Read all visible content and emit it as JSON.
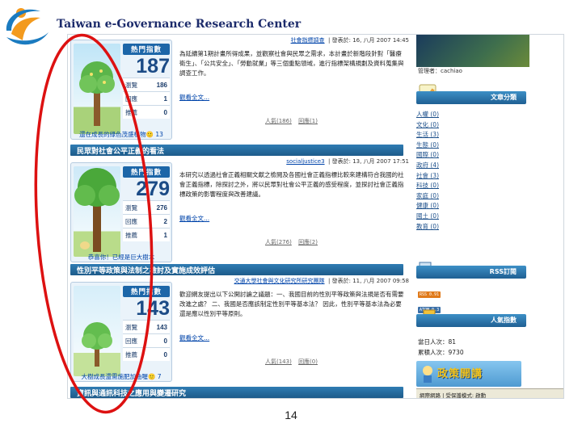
{
  "header": {
    "title": "Taiwan e-Governance Research Center"
  },
  "page_number": "14",
  "posts": [
    {
      "author_prefix": "",
      "author": "社會指標調查",
      "posted_at": "發表於: 16, 八月 2007 14:45",
      "hot_label": "熱門指數",
      "hot_count": "187",
      "stats": [
        {
          "label": "瀏覽",
          "value": "186"
        },
        {
          "label": "回應",
          "value": "1"
        },
        {
          "label": "推薦",
          "value": "0"
        }
      ],
      "caption": "還在成長的綠色茂盛植物🙂 13",
      "body": "為延續第1期計畫所得成果，並觀察社會與民眾之需求，本計畫於新階段針對「醫療衛生」、「公共安全」、「勞動就業」等三個重點領域，進行指標架構規劃及資料蒐集與調查工作。",
      "read_more": "觀看全文...",
      "links": [
        "人氣(186)",
        "回應(1)"
      ]
    },
    {
      "section_title": "民眾對社會公平正義的看法",
      "author_prefix": "",
      "author": "socialjustice3",
      "posted_at": "發表於: 13, 八月 2007 17:51",
      "hot_label": "熱門指數",
      "hot_count": "279",
      "stats": [
        {
          "label": "瀏覽",
          "value": "276"
        },
        {
          "label": "回應",
          "value": "2"
        },
        {
          "label": "推薦",
          "value": "1"
        }
      ],
      "caption": "恭喜你！已經是巨大樹木",
      "body": "本研究以透過社會正義相關文獻之檢閱及各國社會正義指標比較來建構符合我國的社會正義指標，除探討之外，將以民眾對社會公平正義的感受程度，並探討社會正義指標政策的影響程度與改善建議。",
      "read_more": "觀看全文...",
      "links": [
        "人氣(276)",
        "回應(2)"
      ]
    },
    {
      "section_title": "性別平等政策與法制之檢討及實施成效評估",
      "author_prefix": "",
      "author": "交通大學社會與文化研究所研究團隊",
      "posted_at": "發表於: 11, 八月 2007 09:58",
      "hot_label": "熱門指數",
      "hot_count": "143",
      "stats": [
        {
          "label": "瀏覽",
          "value": "143"
        },
        {
          "label": "回應",
          "value": "0"
        },
        {
          "label": "推薦",
          "value": "0"
        }
      ],
      "caption": "大樹成長還需施肥加油喔🙂 7",
      "body": "歡迎網友提出以下公開討論之議題：一、我國目前的性別平等政策與法規是否有需要改進之處？ 二、我國是否應該制定性別平等基本法？ 因此，性別平等基本法為必要還是應以性別平等原則。",
      "read_more": "觀看全文...",
      "links": [
        "人氣(143)",
        "回應(0)"
      ]
    },
    {
      "section_title": "資訊與通訊科技之應用與變遷研究"
    }
  ],
  "sidebar": {
    "owner_label": "管理者：cachiao",
    "categories_title": "文章分類",
    "categories": [
      "人權 (0)",
      "文化 (0)",
      "生活 (3)",
      "生態 (0)",
      "國際 (0)",
      "政府 (4)",
      "社會 (3)",
      "科技 (0)",
      "家庭 (0)",
      "健康 (0)",
      "國土 (0)",
      "教育 (0)"
    ],
    "rss_title": "RSS訂閱",
    "rss_badges": [
      "RSS 0.91",
      "ATOM 0.3"
    ],
    "popularity_title": "人氣指數",
    "visitors_today": "當日人次：81",
    "visitors_total": "累積人次：9730",
    "banner_text": "政策開講"
  },
  "status_bar": "網際網路 | 受保護模式: 啟動",
  "colors": {
    "title": "#1c2b6b",
    "accent": "#1c66a8",
    "link": "#0044aa",
    "annotation": "#dd1111"
  }
}
